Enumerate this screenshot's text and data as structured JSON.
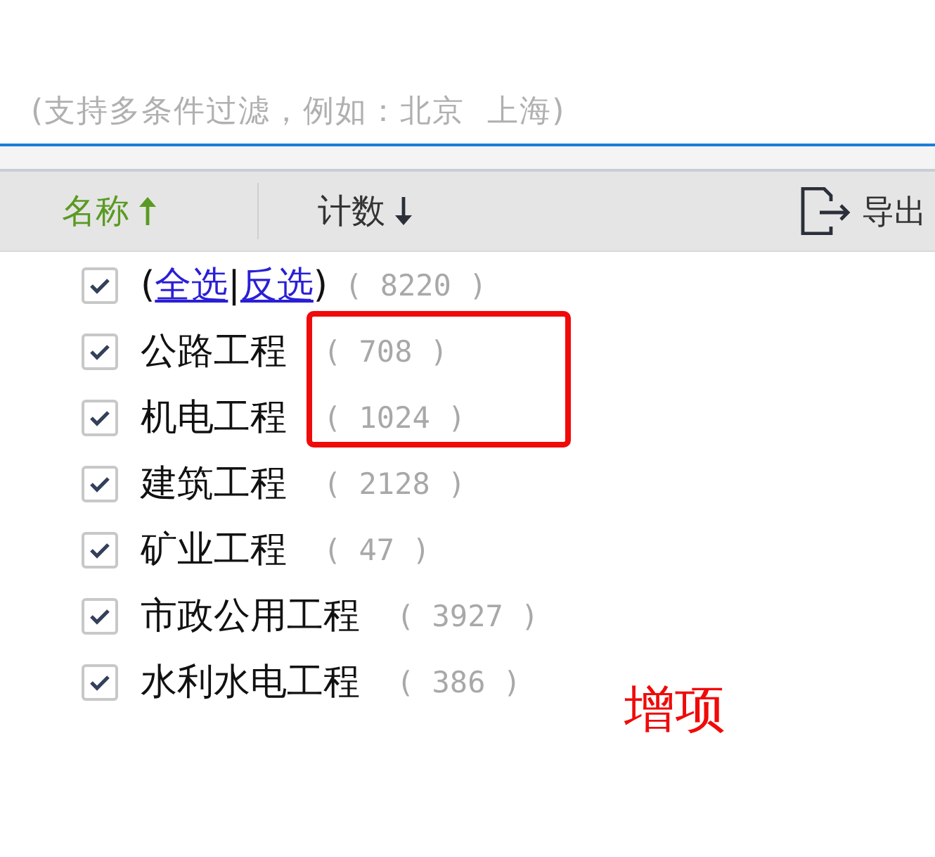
{
  "filter": {
    "placeholder": "(支持多条件过滤，例如：北京  上海)"
  },
  "header": {
    "columns": [
      {
        "label": "名称",
        "ascending": true,
        "selected": true
      },
      {
        "label": "计数",
        "ascending": false,
        "selected": false
      }
    ],
    "export": {
      "label": "导出"
    }
  },
  "select_all": {
    "open": "(",
    "links": [
      {
        "label": "全选"
      },
      {
        "label": "反选"
      }
    ],
    "separator": "|",
    "close": ")",
    "count": "( 8220 )",
    "checked": true
  },
  "items": [
    {
      "label": "公路工程",
      "count": "( 708 )",
      "checked": true,
      "highlighted": true
    },
    {
      "label": "机电工程",
      "count": "( 1024 )",
      "checked": true,
      "highlighted": true
    },
    {
      "label": "建筑工程",
      "count": "( 2128 )",
      "checked": true,
      "highlighted": false
    },
    {
      "label": "矿业工程",
      "count": "( 47 )",
      "checked": true,
      "highlighted": false
    },
    {
      "label": "市政公用工程",
      "count": "( 3927 )",
      "checked": true,
      "highlighted": false
    },
    {
      "label": "水利水电工程",
      "count": "( 386 )",
      "checked": true,
      "highlighted": false
    }
  ],
  "annotation": {
    "label": "增项"
  }
}
